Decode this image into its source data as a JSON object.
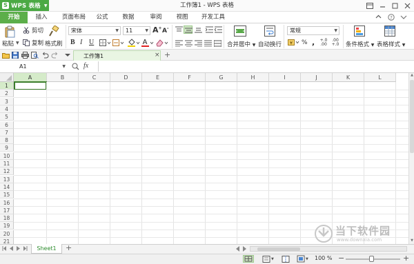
{
  "app": {
    "name": "WPS 表格",
    "window_title": "工作簿1 - WPS 表格"
  },
  "menu_tabs": [
    "开始",
    "插入",
    "页面布局",
    "公式",
    "数据",
    "审阅",
    "视图",
    "开发工具"
  ],
  "ribbon": {
    "paste": "粘贴",
    "cut": "剪切",
    "copy": "复制",
    "format_painter": "格式刷",
    "font_name": "宋体",
    "font_size": "11",
    "merge_center": "合并居中",
    "wrap_text": "自动换行",
    "number_format": "常规",
    "conditional_format": "条件格式",
    "table_style": "表格样式",
    "grow_font": "A",
    "shrink_font": "A",
    "bold": "B",
    "italic": "I",
    "underline": "U",
    "font_color_letter": "A",
    "percent": "%",
    "thousands": ",",
    "dec_inc": "+.0 .00",
    "dec_dec": ".00 +.0"
  },
  "document_tab": {
    "name": "工作簿1",
    "close": "×",
    "add": "+"
  },
  "formula_bar": {
    "cell_ref": "A1",
    "fx": "fx",
    "formula": ""
  },
  "columns": [
    "A",
    "B",
    "C",
    "D",
    "E",
    "F",
    "G",
    "H",
    "I",
    "J",
    "K",
    "L"
  ],
  "rows": [
    "1",
    "2",
    "3",
    "4",
    "5",
    "6",
    "7",
    "8",
    "9",
    "10",
    "11",
    "12",
    "13",
    "14",
    "15",
    "16",
    "17",
    "18",
    "19",
    "20",
    "21"
  ],
  "selected_cell": "A1",
  "sheets": {
    "active": "Sheet1",
    "add": "+"
  },
  "status": {
    "zoom": "100 %",
    "zoom_minus": "−",
    "zoom_plus": "+"
  },
  "watermark": {
    "site_cn": "当下软件园",
    "site_url": "www.downxia.com"
  },
  "colors": {
    "accent": "#4ba944",
    "tab_active": "#5cae4a",
    "selection_header": "#d5ebc9",
    "active_cell_border": "#3b7d2a"
  }
}
